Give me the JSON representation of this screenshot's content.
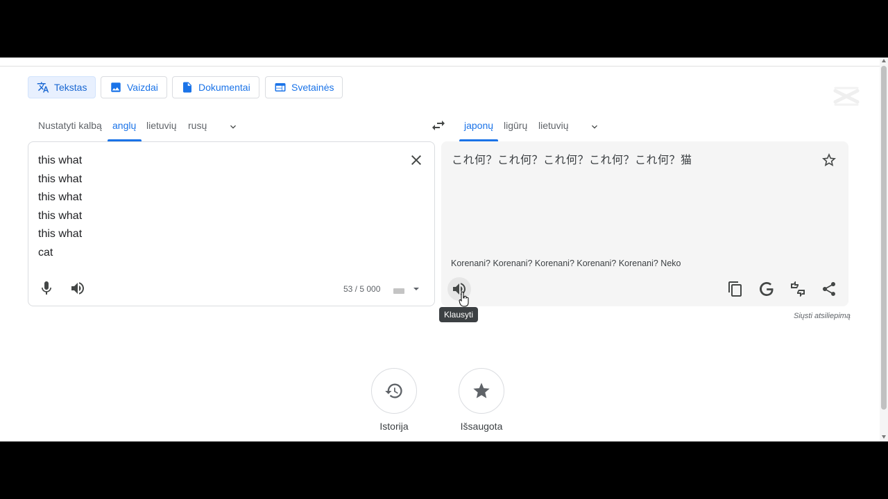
{
  "modes": [
    {
      "label": "Tekstas",
      "icon": "translate-icon",
      "active": true
    },
    {
      "label": "Vaizdai",
      "icon": "image-icon",
      "active": false
    },
    {
      "label": "Dokumentai",
      "icon": "document-icon",
      "active": false
    },
    {
      "label": "Svetainės",
      "icon": "website-icon",
      "active": false
    }
  ],
  "source_langs": [
    "Nustatyti kalbą",
    "anglų",
    "lietuvių",
    "rusų"
  ],
  "target_langs": [
    "japonų",
    "ligūrų",
    "lietuvių"
  ],
  "source": {
    "text": "this what\nthis what\nthis what\nthis what\nthis what\ncat",
    "counter": "53 / 5 000"
  },
  "target": {
    "text": "これ何？これ何？これ何？これ何？これ何？猫",
    "transliteration": "Korenani? Korenani? Korenani? Korenani? Korenani? Neko"
  },
  "tooltip": "Klausyti",
  "feedback": "Siųsti atsiliepimą",
  "bottom": [
    {
      "label": "Istorija",
      "icon": "history-icon"
    },
    {
      "label": "Išsaugota",
      "icon": "star-filled-icon"
    }
  ],
  "colors": {
    "accent": "#1a73e8",
    "active_bg": "#e8f0fe",
    "target_bg": "#f5f5f5"
  }
}
